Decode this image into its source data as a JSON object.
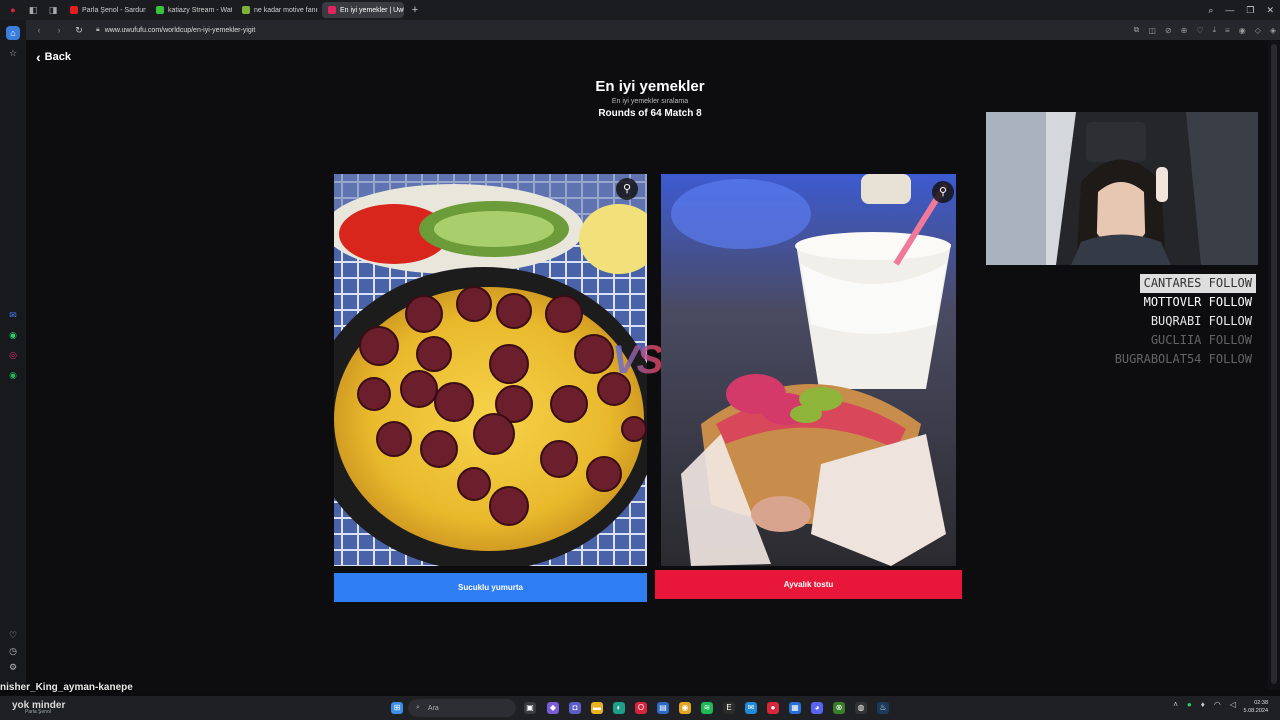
{
  "browser": {
    "tabs": [
      {
        "label": "Parla Şenol - Sardunyalar",
        "fav": "#e02020",
        "active": false
      },
      {
        "label": "katiazy Stream - Watch Li",
        "fav": "#39c43d",
        "active": false
      },
      {
        "label": "ne kadar motive fanısın",
        "fav": "#7fb23a",
        "active": false
      },
      {
        "label": "En iyi yemekler | UwUFUFU",
        "fav": "#e0245e",
        "active": true
      }
    ],
    "url": "www.uwufufu.com/worldcup/en-iyi-yemekler-yigit"
  },
  "page": {
    "back_label": "Back",
    "title": "En iyi yemekler",
    "subtitle": "En iyi yemekler sıralama",
    "round_info": "Rounds of 64 Match 8",
    "vs_text": "VS",
    "left_choice": "Sucuklu yumurta",
    "right_choice": "Ayvalık tostu"
  },
  "colors": {
    "left_button": "#2f7df3",
    "right_button": "#e8173a"
  },
  "overlay": {
    "followers": [
      {
        "name": "CANTARES",
        "action": "FOLLOW",
        "opacity": 1.0,
        "highlight": true
      },
      {
        "name": "MOTTOVLR",
        "action": "FOLLOW",
        "opacity": 1.0,
        "highlight": false
      },
      {
        "name": "BUQRABI",
        "action": "FOLLOW",
        "opacity": 0.9,
        "highlight": false
      },
      {
        "name": "GUCLIIA",
        "action": "FOLLOW",
        "opacity": 0.35,
        "highlight": false
      },
      {
        "name": "BUGRABOLAT54",
        "action": "FOLLOW",
        "opacity": 0.35,
        "highlight": false
      }
    ],
    "chat_line": "nisher_King_ayman-kanepe",
    "now_playing": "yok minder",
    "now_playing_sub": "Parla Şenol"
  },
  "taskbar": {
    "search_placeholder": "Ara",
    "time": "02:38",
    "date": "5.08.2024"
  }
}
